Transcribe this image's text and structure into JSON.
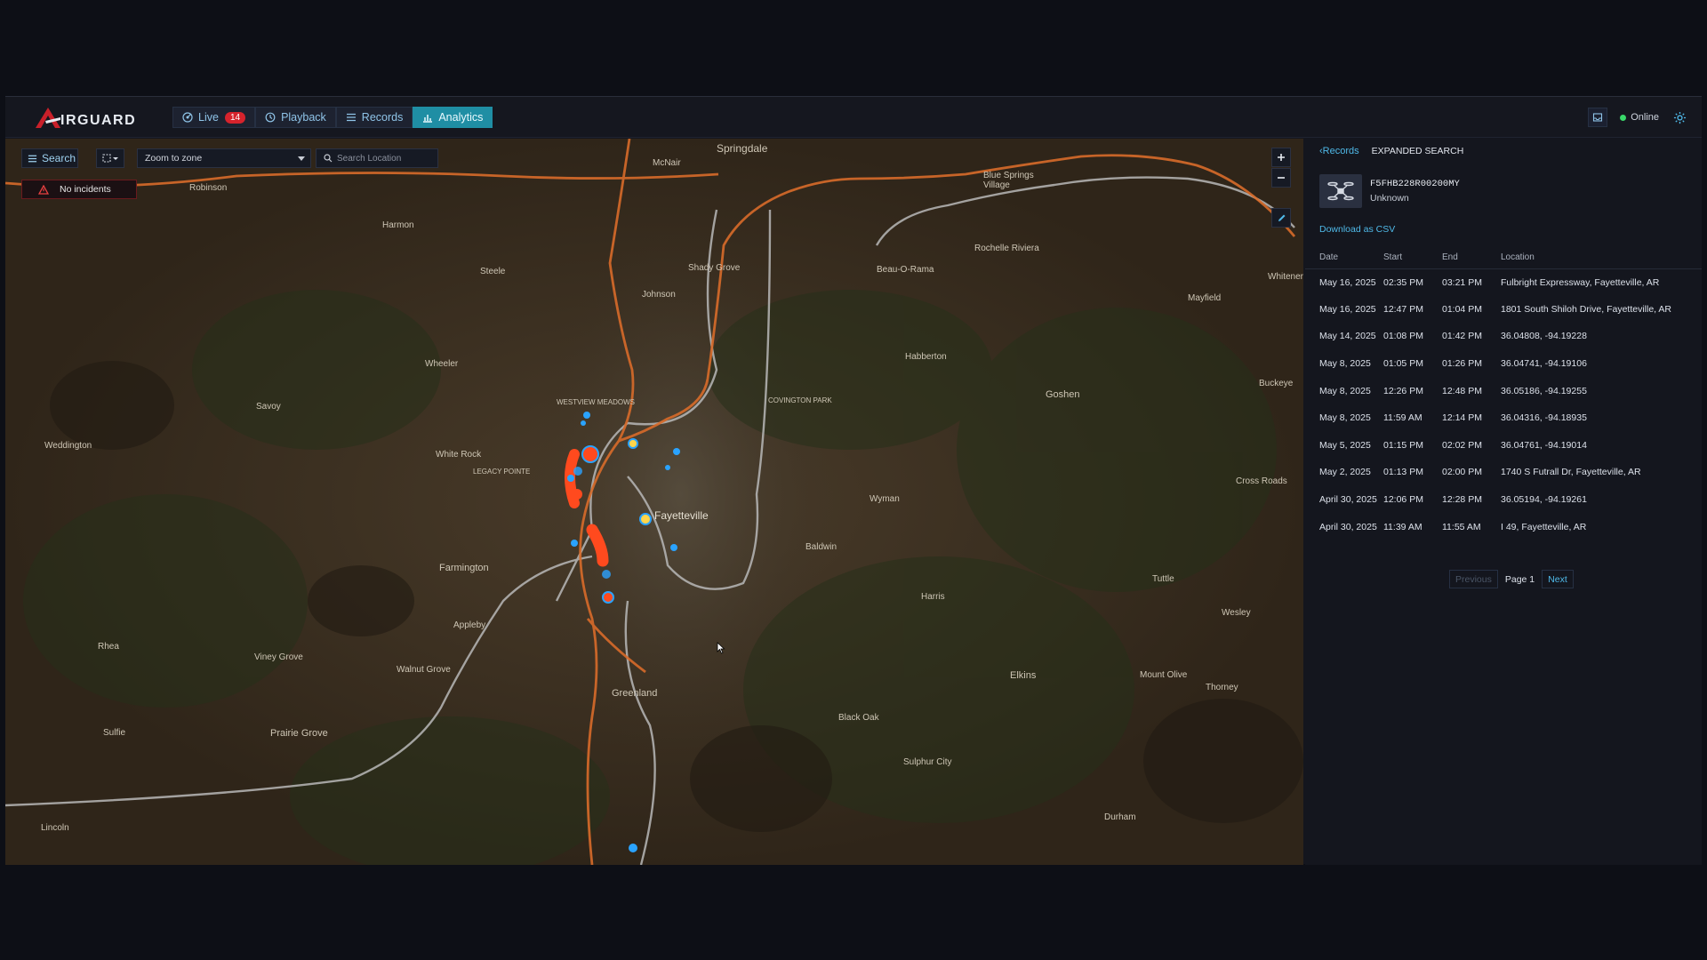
{
  "app": {
    "brand": "IRGUARD",
    "brand_initial": "A"
  },
  "nav": {
    "tabs": [
      {
        "label": "Live",
        "badge": "14",
        "icon": "radar-icon"
      },
      {
        "label": "Playback",
        "icon": "history-icon"
      },
      {
        "label": "Records",
        "icon": "list-icon"
      },
      {
        "label": "Analytics",
        "icon": "bar-chart-icon",
        "active": true
      }
    ]
  },
  "status": {
    "label": "Online",
    "color": "#39d86a"
  },
  "map": {
    "search_label": "Search",
    "zone_select": {
      "value": "Zoom to zone"
    },
    "location_search": {
      "placeholder": "Search Location"
    },
    "incident_label": "No incidents",
    "labels": {
      "springdale": "Springdale",
      "fayetteville": "Fayetteville",
      "farmington": "Farmington",
      "greenland": "Greenland",
      "prairie_grove": "Prairie Grove",
      "elkins": "Elkins",
      "goshen": "Goshen",
      "johnson": "Johnson",
      "black_oak": "Black Oak",
      "sulphur_city": "Sulphur City",
      "wheeler": "Wheeler",
      "savoy": "Savoy",
      "harmon": "Harmon",
      "steele": "Steele",
      "robinson": "Robinson",
      "weddington": "Weddington",
      "viney_grove": "Viney Grove",
      "lincoln": "Lincoln",
      "sulfie": "Sulfie",
      "wyman": "Wyman",
      "harris": "Harris",
      "baldwin": "Baldwin",
      "covington_park": "COVINGTON PARK",
      "westview_meadows": "WESTVIEW MEADOWS",
      "habberton": "Habberton",
      "beau_o_rama": "Beau-O-Rama",
      "rochelle_riviera": "Rochelle Riviera",
      "blue_springs": "Blue Springs Village",
      "mayfield": "Mayfield",
      "buckeye": "Buckeye",
      "cross_roads": "Cross Roads",
      "tuttle": "Tuttle",
      "wesley": "Wesley",
      "mount_olive": "Mount Olive",
      "thorney": "Thorney",
      "durham": "Durham",
      "appleby": "Appleby",
      "walnut_grove": "Walnut Grove",
      "rhea": "Rhea",
      "white_rock": "White Rock",
      "legacy_pointe": "LEGACY POINTE",
      "mcnair": "McNair",
      "wheeler2": "Whitener",
      "shady_grove": "Shady Grove"
    }
  },
  "panel": {
    "back_label": "Records",
    "title": "EXPANDED SEARCH",
    "drone": {
      "id": "F5FHB228R00200MY",
      "type": "Unknown"
    },
    "download_label": "Download as CSV",
    "columns": [
      "Date",
      "Start",
      "End",
      "Location"
    ],
    "rows": [
      [
        "May 16, 2025",
        "02:35 PM",
        "03:21 PM",
        "Fulbright Expressway, Fayetteville, AR"
      ],
      [
        "May 16, 2025",
        "12:47 PM",
        "01:04 PM",
        "1801 South Shiloh Drive, Fayetteville, AR"
      ],
      [
        "May 14, 2025",
        "01:08 PM",
        "01:42 PM",
        "36.04808, -94.19228"
      ],
      [
        "May 8, 2025",
        "01:05 PM",
        "01:26 PM",
        "36.04741, -94.19106"
      ],
      [
        "May 8, 2025",
        "12:26 PM",
        "12:48 PM",
        "36.05186, -94.19255"
      ],
      [
        "May 8, 2025",
        "11:59 AM",
        "12:14 PM",
        "36.04316, -94.18935"
      ],
      [
        "May 5, 2025",
        "01:15 PM",
        "02:02 PM",
        "36.04761, -94.19014"
      ],
      [
        "May 2, 2025",
        "01:13 PM",
        "02:00 PM",
        "1740 S Futrall Dr, Fayetteville, AR"
      ],
      [
        "April 30, 2025",
        "12:06 PM",
        "12:28 PM",
        "36.05194, -94.19261"
      ],
      [
        "April 30, 2025",
        "11:39 AM",
        "11:55 AM",
        "I 49, Fayetteville, AR"
      ]
    ],
    "pagination": {
      "previous": "Previous",
      "page": "Page 1",
      "next": "Next"
    }
  }
}
